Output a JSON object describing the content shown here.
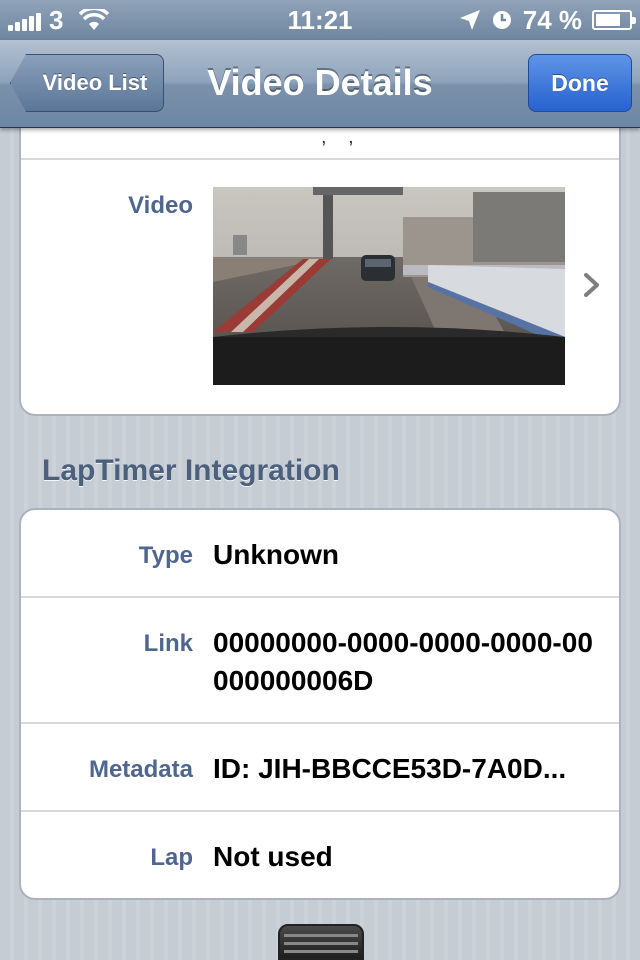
{
  "status_bar": {
    "carrier": "3",
    "time": "11:21",
    "battery_percent": "74 %",
    "battery_level": 0.74,
    "icons": [
      "signal-bars-icon",
      "wifi-icon",
      "location-arrow-icon",
      "alarm-clock-icon",
      "battery-icon"
    ]
  },
  "nav": {
    "back_label": "Video List",
    "title": "Video Details",
    "done_label": "Done"
  },
  "video_section": {
    "label": "Video",
    "thumbnail": "race-track-pit-lane-video-thumbnail",
    "disclosure_icon": "chevron-right-icon"
  },
  "laptimer": {
    "header": "LapTimer Integration",
    "rows": [
      {
        "label": "Type",
        "value": "Unknown"
      },
      {
        "label": "Link",
        "value": "00000000-0000-0000-0000-00000000006D"
      },
      {
        "label": "Metadata",
        "value": "ID: JIH-BBCCE53D-7A0D..."
      },
      {
        "label": "Lap",
        "value": "Not used"
      }
    ]
  },
  "colors": {
    "nav_gradient_top": "#b3c1d1",
    "done_button": "#2762cf",
    "label_blue": "#4f6690",
    "section_header": "#4c5f7c",
    "background": "#c5ccd4"
  }
}
